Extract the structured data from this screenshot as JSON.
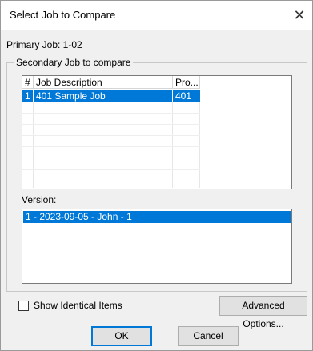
{
  "window": {
    "title": "Select Job to Compare",
    "close_glyph": "✕"
  },
  "primary_job": "Primary Job: 1-02",
  "secondary_group": {
    "legend": "Secondary Job to compare"
  },
  "job_list": {
    "columns": [
      "#",
      "Job Description",
      "Pro..."
    ],
    "rows": [
      {
        "num": "1",
        "description": "401 Sample Job",
        "pro": "401",
        "selected": true
      }
    ]
  },
  "version_section": {
    "label": "Version:",
    "items": [
      {
        "text": "1 - 2023-09-05 - John - 1",
        "selected": true
      }
    ]
  },
  "options": {
    "show_identical_label": "Show Identical Items",
    "show_identical_checked": false
  },
  "buttons": {
    "advanced": "Advanced Options...",
    "ok": "OK",
    "cancel": "Cancel"
  },
  "colors": {
    "selection": "#0078d7",
    "dialog_bg": "#f0f0f0"
  }
}
